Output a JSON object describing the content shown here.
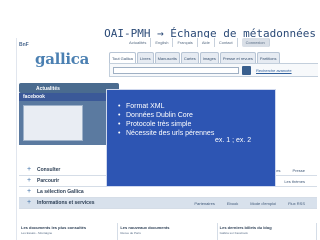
{
  "slide_title": "OAI-PMH → Échange de métadonnées",
  "screenshot": {
    "bnf_label": "BnF",
    "logo": "gallica",
    "top_links": [
      "Actualités",
      "English",
      "Français",
      "Aide",
      "Contact"
    ],
    "top_button": "Connexion",
    "tabs": [
      "Tout Gallica",
      "Livres",
      "Manuscrits",
      "Cartes",
      "Images",
      "Presse et revues",
      "Partitions",
      "Vidéo",
      "Son"
    ],
    "advanced_search": "Recherche avancée",
    "news_header": "Actualités",
    "feature_source": "facebook",
    "rows": [
      {
        "label": "Consulter",
        "extra": [
          "Livres",
          "Images",
          "Presse"
        ]
      },
      {
        "label": "Parcourir",
        "extra": [
          "Les dossiers",
          "Les thèmes"
        ]
      },
      {
        "label": "La sélection Gallica",
        "extra": []
      },
      {
        "label": "Informations et services",
        "extra": [
          "Partenaires",
          "Ebook",
          "Mode d'emploi",
          "Flux RSS"
        ]
      }
    ],
    "bottom_columns": [
      {
        "title": "Les documents les plus consultés",
        "line": "Les Essais - Montaigne"
      },
      {
        "title": "Les nouveaux documents",
        "line": "Revue de Paris"
      },
      {
        "title": "Les derniers billets du blog",
        "line": "Gallica sur Facebook"
      }
    ]
  },
  "overlay": {
    "bullets": [
      "Format XML",
      "Données Dublin Core",
      "Protocole très simple",
      "Nécessite des urls pérennes"
    ],
    "references": "ex. 1 ; ex. 2"
  }
}
